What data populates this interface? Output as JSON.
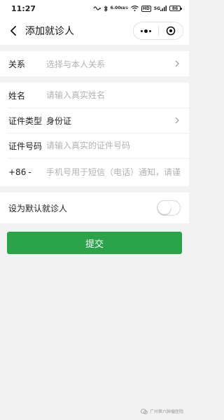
{
  "status_bar": {
    "time": "11:27",
    "speed_value": "6.00",
    "speed_unit": "KB/S",
    "hd": "HD",
    "network": "5G",
    "battery": "86"
  },
  "nav": {
    "title": "添加就诊人"
  },
  "form": {
    "relation": {
      "label": "关系",
      "placeholder": "选择与本人关系"
    },
    "name": {
      "label": "姓名",
      "placeholder": "请输入真实姓名"
    },
    "id_type": {
      "label": "证件类型",
      "value": "身份证"
    },
    "id_number": {
      "label": "证件号码",
      "placeholder": "请输入真实的证件号码"
    },
    "phone": {
      "prefix": "+86",
      "placeholder": "手机号用于短信（电话）通知，请谨慎填写"
    },
    "default_patient": {
      "label": "设为默认就诊人",
      "on": false
    }
  },
  "submit_label": "提交",
  "watermark": "广州第六肿瘤医院",
  "colors": {
    "accent": "#2aa34a",
    "placeholder": "#b2b2b2",
    "background": "#f2f2f2"
  }
}
